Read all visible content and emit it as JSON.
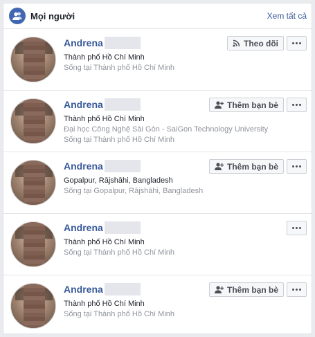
{
  "header": {
    "title": "Mọi người",
    "see_all": "Xem tất cả"
  },
  "people": [
    {
      "name": "Andrena",
      "line1": "Thành phố Hồ Chí Minh",
      "line2": [
        "Sống tại Thành phố Hồ Chí Minh"
      ],
      "primary_action": "follow",
      "action_label": "Theo dõi"
    },
    {
      "name": "Andrena",
      "line1": "Thành phố Hồ Chí Minh",
      "line2": [
        "Đại học Công Nghệ Sài Gòn - SaiGon Technology University",
        "Sống tại Thành phố Hồ Chí Minh"
      ],
      "primary_action": "add-friend",
      "action_label": "Thêm bạn bè"
    },
    {
      "name": "Andrena",
      "line1": "Gopalpur, Rājshāhi, Bangladesh",
      "line2": [
        "Sống tại Gopalpur, Rājshāhi, Bangladesh"
      ],
      "primary_action": "add-friend",
      "action_label": "Thêm bạn bè"
    },
    {
      "name": "Andrena",
      "line1": "Thành phố Hồ Chí Minh",
      "line2": [
        "Sống tại Thành phố Hồ Chí Minh"
      ],
      "primary_action": "none",
      "action_label": ""
    },
    {
      "name": "Andrena",
      "line1": "Thành phố Hồ Chí Minh",
      "line2": [
        "Sống tại Thành phố Hồ Chí Minh"
      ],
      "primary_action": "add-friend",
      "action_label": "Thêm bạn bè"
    }
  ],
  "colors": {
    "link": "#365899",
    "brand": "#4267b2",
    "muted": "#90949c"
  }
}
